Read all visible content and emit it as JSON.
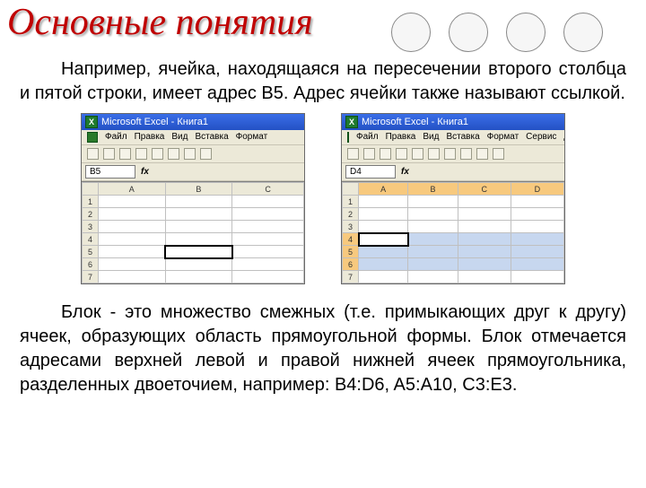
{
  "page": {
    "title": "Основные понятия",
    "para1": "Например, ячейка, находящаяся на пересечении второго столбца и пятой строки, имеет адрес B5. Адрес ячейки также называют ссылкой.",
    "para2": "Блок - это множество смежных (т.е. примыкающих друг к другу) ячеек, образующих область прямоугольной формы. Блок отмечается адресами верхней левой и правой нижней ячеек прямоугольника, разделенных двоеточием, например: B4:D6, A5:A10, C3:E3."
  },
  "excel_left": {
    "app_title": "Microsoft Excel - Книга1",
    "menu": [
      "Файл",
      "Правка",
      "Вид",
      "Вставка",
      "Формат"
    ],
    "namebox": "B5",
    "cols": [
      "A",
      "B",
      "C"
    ],
    "rows": [
      "1",
      "2",
      "3",
      "4",
      "5",
      "6",
      "7"
    ],
    "selected_cell": "B5"
  },
  "excel_right": {
    "app_title": "Microsoft Excel - Книга1",
    "menu": [
      "Файл",
      "Правка",
      "Вид",
      "Вставка",
      "Формат",
      "Сервис",
      "Да"
    ],
    "namebox": "D4",
    "cols": [
      "A",
      "B",
      "C",
      "D"
    ],
    "rows": [
      "1",
      "2",
      "3",
      "4",
      "5",
      "6",
      "7"
    ],
    "range": "A4:D6"
  }
}
